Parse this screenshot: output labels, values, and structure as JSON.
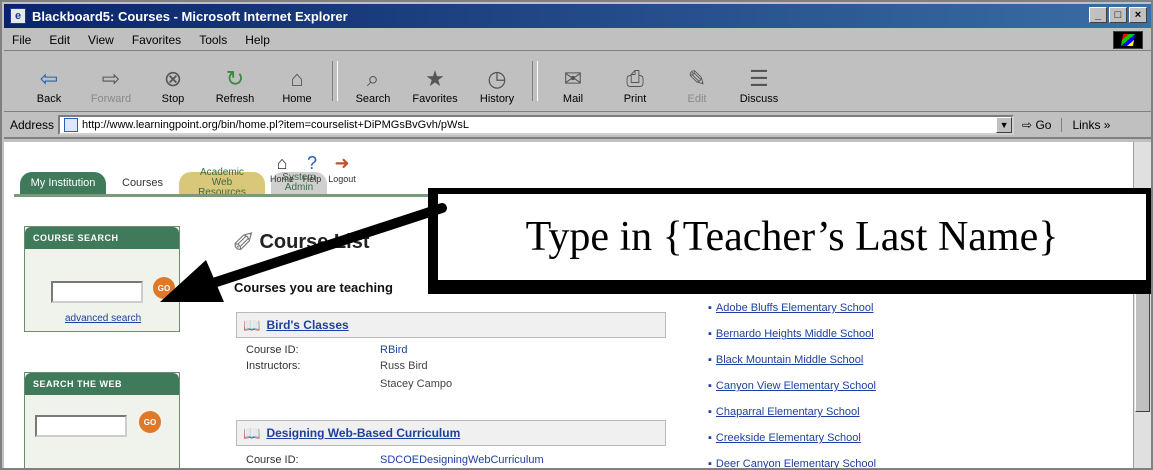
{
  "window": {
    "title": "Blackboard5: Courses - Microsoft Internet Explorer",
    "controls": {
      "minimize": "_",
      "maximize": "□",
      "close": "×"
    }
  },
  "menu": [
    "File",
    "Edit",
    "View",
    "Favorites",
    "Tools",
    "Help"
  ],
  "toolbar": {
    "buttons": [
      {
        "label": "Back",
        "icon": "back-arrow",
        "glyph": "⇦",
        "enabled": true
      },
      {
        "label": "Forward",
        "icon": "forward-arrow",
        "glyph": "⇨",
        "enabled": false
      },
      {
        "label": "Stop",
        "icon": "stop",
        "glyph": "⊗",
        "enabled": true
      },
      {
        "label": "Refresh",
        "icon": "refresh",
        "glyph": "↻",
        "enabled": true
      },
      {
        "label": "Home",
        "icon": "home",
        "glyph": "⌂",
        "enabled": true
      },
      {
        "label": "Search",
        "icon": "search",
        "glyph": "⌕",
        "enabled": true
      },
      {
        "label": "Favorites",
        "icon": "favorites",
        "glyph": "★",
        "enabled": true
      },
      {
        "label": "History",
        "icon": "history",
        "glyph": "◷",
        "enabled": true
      },
      {
        "label": "Mail",
        "icon": "mail",
        "glyph": "✉",
        "enabled": true
      },
      {
        "label": "Print",
        "icon": "print",
        "glyph": "⎙",
        "enabled": true
      },
      {
        "label": "Edit",
        "icon": "edit",
        "glyph": "✎",
        "enabled": false
      },
      {
        "label": "Discuss",
        "icon": "discuss",
        "glyph": "☰",
        "enabled": true
      }
    ]
  },
  "address": {
    "label": "Address",
    "url": "http://www.learningpoint.org/bin/home.pl?item=courselist+DiPMGsBvGvh/pWsL",
    "go": "Go",
    "links": "Links »"
  },
  "nav": {
    "tabs": {
      "my_institution": "My Institution",
      "courses": "Courses",
      "academic_line1": "Academic",
      "academic_line2": "Web Resources",
      "system_line1": "System",
      "system_line2": "Admin"
    },
    "icons": {
      "home": "Home",
      "help": "Help",
      "logout": "Logout"
    }
  },
  "course_search": {
    "heading": "COURSE SEARCH",
    "go": "GO",
    "advanced": "advanced search"
  },
  "web_search": {
    "heading": "SEARCH THE WEB",
    "go": "GO"
  },
  "course_list": {
    "title": "Course List",
    "teaching_heading": "Courses you are teaching",
    "courses": [
      {
        "name": "Bird's Classes",
        "course_id_label": "Course ID:",
        "course_id": "RBird",
        "instructors_label": "Instructors:",
        "instructors": [
          "Russ Bird",
          "Stacey Campo"
        ]
      },
      {
        "name": "Designing Web-Based Curriculum",
        "course_id_label": "Course ID:",
        "course_id": "SDCOEDesigningWebCurriculum"
      }
    ]
  },
  "schools": [
    "Adobe Bluffs Elementary School",
    "Bernardo Heights Middle School",
    "Black Mountain Middle School",
    "Canyon View Elementary School",
    "Chaparral Elementary School",
    "Creekside Elementary School",
    "Deer Canyon Elementary School"
  ],
  "callout": {
    "text": "Type in {Teacher’s Last Name}"
  }
}
